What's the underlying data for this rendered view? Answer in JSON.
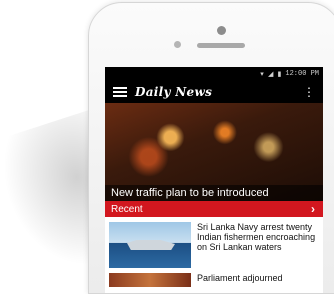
{
  "status_bar": {
    "icons": "▾ ◢ ▮",
    "time": "12:00 PM"
  },
  "app": {
    "logo": "Daily News"
  },
  "hero": {
    "caption": "New traffic plan to be introduced"
  },
  "section": {
    "label": "Recent",
    "chevron": "›"
  },
  "stories": [
    {
      "title": "Sri Lanka Navy arrest twenty Indian fishermen encroaching on Sri Lankan waters"
    },
    {
      "title": "Parliament adjourned"
    }
  ]
}
